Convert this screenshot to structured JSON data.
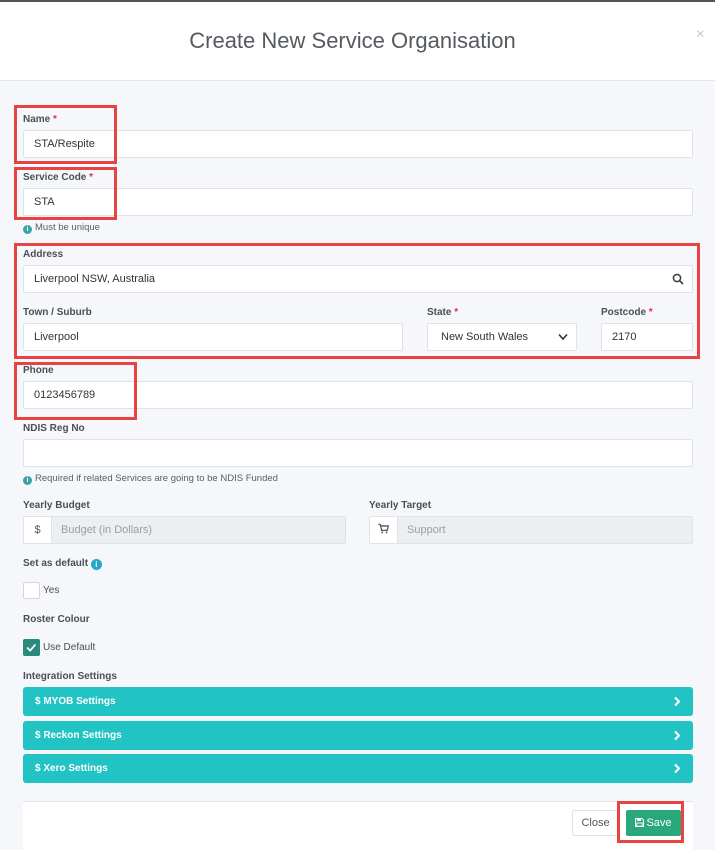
{
  "modal": {
    "title": "Create New Service Organisation",
    "close_glyph": "×"
  },
  "form": {
    "required_mark": "*",
    "name": {
      "label": "Name",
      "value": "STA/Respite"
    },
    "service_code": {
      "label": "Service Code",
      "value": "STA",
      "hint": "Must be unique"
    },
    "address": {
      "label": "Address",
      "value": "Liverpool NSW, Australia",
      "icon": "search-icon"
    },
    "town": {
      "label": "Town / Suburb",
      "value": "Liverpool"
    },
    "state": {
      "label": "State",
      "value": "New South Wales"
    },
    "postcode": {
      "label": "Postcode",
      "value": "2170"
    },
    "phone": {
      "label": "Phone",
      "value": "0123456789"
    },
    "ndis": {
      "label": "NDIS Reg No",
      "value": "",
      "hint": "Required if related Services are going to be NDIS Funded"
    },
    "yearly_budget": {
      "label": "Yearly Budget",
      "addon": "$",
      "placeholder": "Budget (in Dollars)"
    },
    "yearly_target": {
      "label": "Yearly Target",
      "addon_icon": "cart-icon",
      "placeholder": "Support"
    },
    "set_default": {
      "label": "Set as default",
      "option": "Yes",
      "checked": false
    },
    "roster_colour": {
      "label": "Roster Colour",
      "option": "Use Default",
      "checked": true
    },
    "integration": {
      "label": "Integration Settings",
      "items": [
        {
          "label": "$ MYOB Settings"
        },
        {
          "label": "$ Reckon Settings"
        },
        {
          "label": "$ Xero Settings"
        }
      ]
    }
  },
  "footer": {
    "close_label": "Close",
    "save_label": "Save"
  },
  "colors": {
    "accent_teal": "#22c3c4",
    "save_green": "#2aa77b",
    "checkbox_green": "#2a8a7e",
    "required_red": "#e03131",
    "highlight_red": "#e84343"
  }
}
